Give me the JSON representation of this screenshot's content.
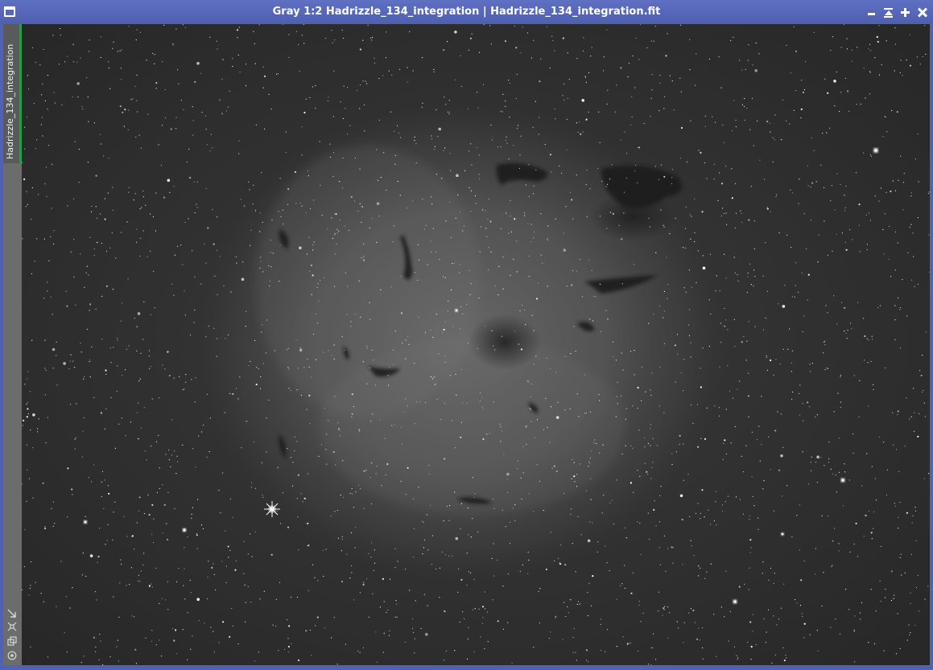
{
  "window": {
    "title": "Gray 1:2 Hadrizzle_134_integration | Hadrizzle_134_integration.fit",
    "controls": [
      "minimize",
      "shade",
      "maximize",
      "close"
    ]
  },
  "sidebar": {
    "view_tab_label": "Hadrizzle_134_integration",
    "tools": [
      {
        "icon": "arrow-diagonal-icon"
      },
      {
        "icon": "fit-view-icon"
      },
      {
        "icon": "clone-view-icon"
      },
      {
        "icon": "target-icon"
      }
    ]
  },
  "image": {
    "subject": "nebula-star-field",
    "mode": "Gray",
    "zoom": "1:2"
  },
  "colors": {
    "titlebar": "#5262b3",
    "active_tab_accent": "#2a9a4e",
    "sidebar": "#6c6c6c"
  }
}
